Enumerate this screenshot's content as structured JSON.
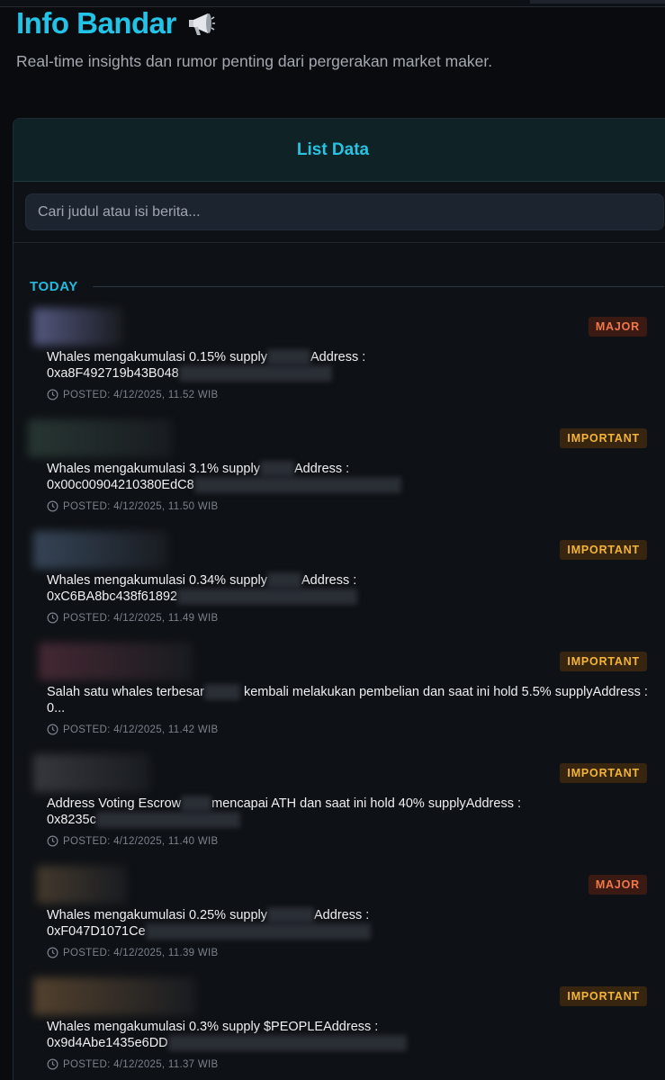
{
  "header": {
    "title": "Info Bandar",
    "icon": "megaphone-icon",
    "subtitle": "Real-time insights dan rumor penting dari pergerakan market maker."
  },
  "panel": {
    "title": "List Data",
    "search_placeholder": "Cari judul atau isi berita..."
  },
  "section": {
    "label": "TODAY"
  },
  "colors": {
    "accent": "#22c3e6",
    "major": "#f0784a",
    "important": "#f2b43a",
    "background": "#090b0f"
  },
  "items": [
    {
      "badge": "MAJOR",
      "text_a": "Whales mengakumulasi 0.15% supply",
      "text_b": "Address :",
      "text_c": "0xa8F492719b43B048",
      "posted": "POSTED: 4/12/2025, 11.52 WIB",
      "avatar_color": "#5c5f8a"
    },
    {
      "badge": "IMPORTANT",
      "text_a": "Whales mengakumulasi 3.1% supply",
      "text_b": "Address :",
      "text_c": "0x00c00904210380EdC8",
      "posted": "POSTED: 4/12/2025, 11.50 WIB",
      "avatar_color": "#2a3a35"
    },
    {
      "badge": "IMPORTANT",
      "text_a": "Whales mengakumulasi 0.34% supply",
      "text_b": "Address :",
      "text_c": "0xC6BA8bc438f61892",
      "posted": "POSTED: 4/12/2025, 11.49 WIB",
      "avatar_color": "#3a4a5e"
    },
    {
      "badge": "IMPORTANT",
      "text_a": "Salah satu whales terbesar",
      "text_b": "kembali melakukan pembelian dan saat ini hold 5.5% supplyAddress :",
      "text_c": "0...",
      "posted": "POSTED: 4/12/2025, 11.42 WIB",
      "avatar_color": "#4a2a35"
    },
    {
      "badge": "IMPORTANT",
      "text_a": "Address Voting Escrow",
      "text_b": "mencapai ATH dan saat ini hold 40% supplyAddress :",
      "text_c": "0x8235c",
      "posted": "POSTED: 4/12/2025, 11.40 WIB",
      "avatar_color": "#3a3c42"
    },
    {
      "badge": "MAJOR",
      "text_a": "Whales mengakumulasi 0.25% supply",
      "text_b": "Address :",
      "text_c": "0xF047D1071Ce",
      "posted": "POSTED: 4/12/2025, 11.39 WIB",
      "avatar_color": "#4a3e30"
    },
    {
      "badge": "IMPORTANT",
      "text_a": "Whales mengakumulasi 0.3% supply $PEOPLEAddress :",
      "text_b": "",
      "text_c": "0x9d4Abe1435e6DD",
      "posted": "POSTED: 4/12/2025, 11.37 WIB",
      "avatar_color": "#5a4630"
    }
  ]
}
